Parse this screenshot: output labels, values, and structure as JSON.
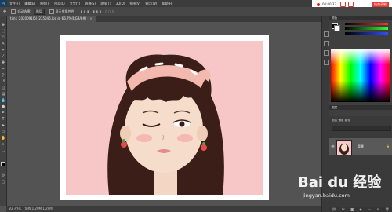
{
  "app": {
    "logo": "Ps"
  },
  "menu": [
    "文件(F)",
    "编辑(E)",
    "图像(I)",
    "图层(L)",
    "文字(Y)",
    "选择(S)",
    "滤镜(T)",
    "3D(D)",
    "视图(V)",
    "窗口(W)",
    "帮助(H)"
  ],
  "recorder": {
    "time": "00:00:33",
    "end_label": "结束录制"
  },
  "options_bar": {
    "auto_select_label": "自动选择:",
    "auto_select_value": "图层",
    "show_transform_label": "显示变换控件"
  },
  "document_tab": {
    "title": "timk_2020091(5)_235046.jpg @ 66.7%(RGB/8#)",
    "close": "×"
  },
  "status_bar": {
    "zoom": "66.67%",
    "doc_info": "文档:1.29M/1.29M"
  },
  "panels": {
    "color_header": "颜色",
    "swatches_header": "色板",
    "layers_header": "图层",
    "layers_tabs": "图层  通道  路径"
  },
  "layer": {
    "name": "背景"
  },
  "watermark": {
    "brand": "Bai du 经验",
    "url": "jingyan.baidu.com"
  },
  "colors": {
    "accent": "#e53935",
    "canvas_bg": "#f7c7c7",
    "ps_blue": "#4fb2ff"
  }
}
